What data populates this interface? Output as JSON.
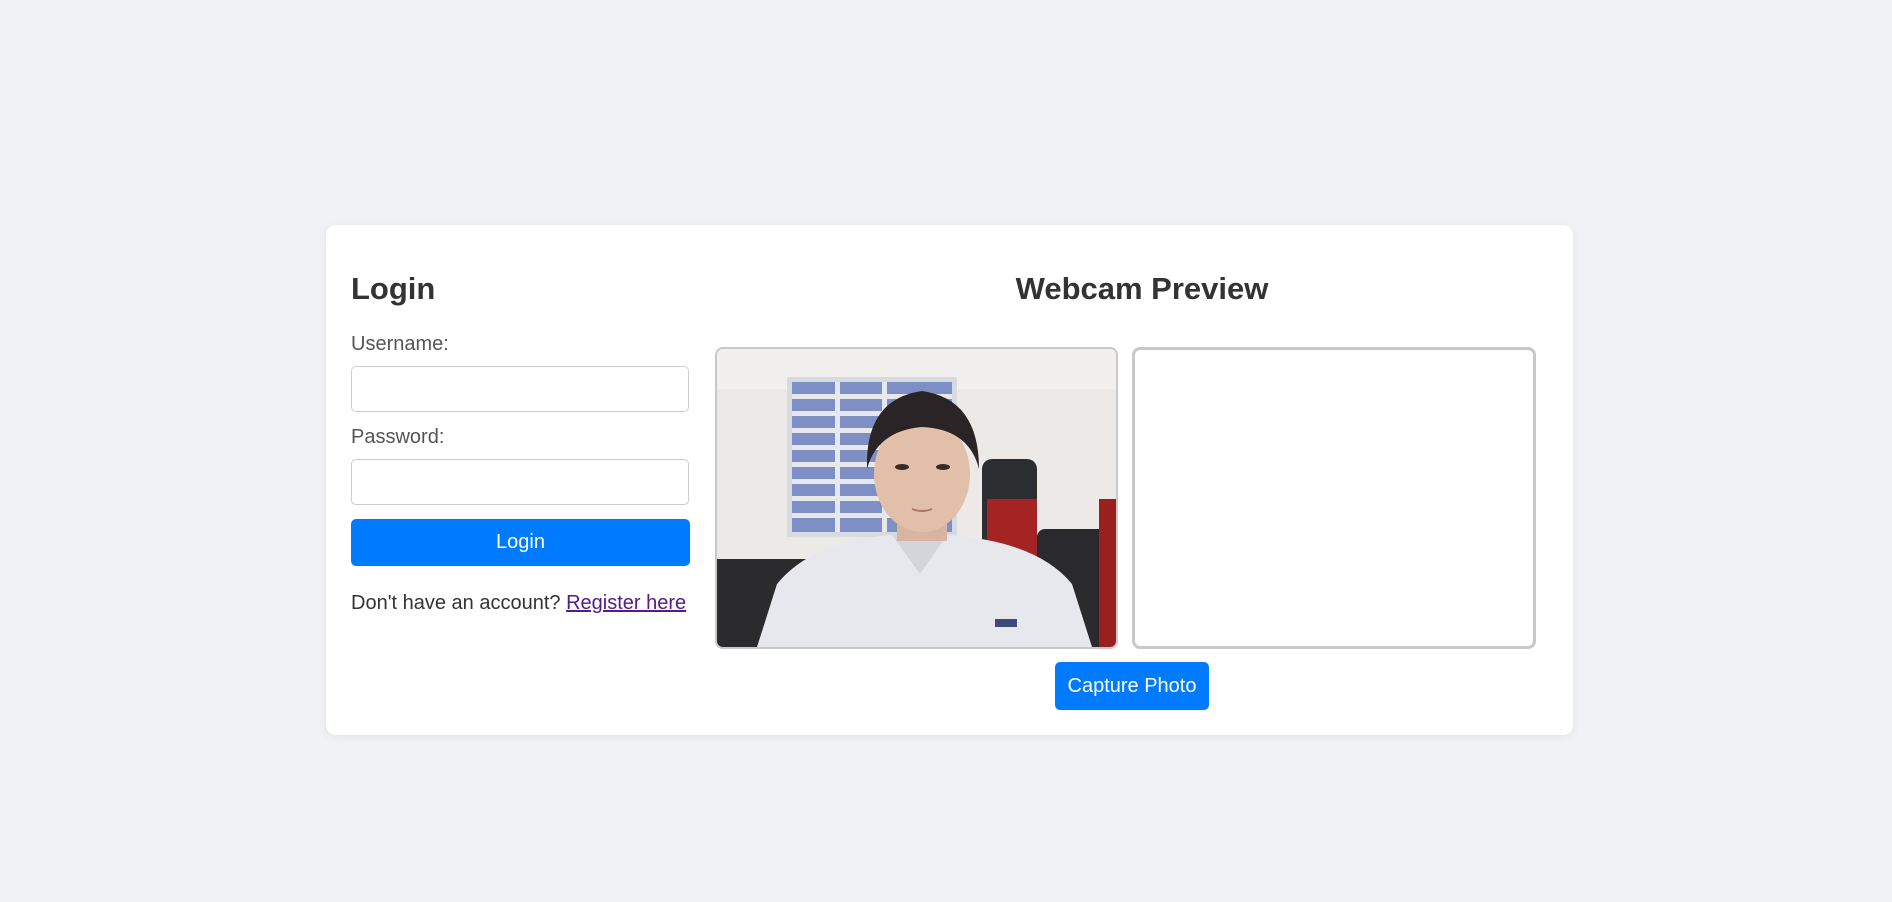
{
  "login": {
    "title": "Login",
    "username_label": "Username:",
    "username_value": "",
    "password_label": "Password:",
    "password_value": "",
    "login_button": "Login",
    "register_prompt": "Don't have an account?",
    "register_link": "Register here"
  },
  "webcam": {
    "title": "Webcam Preview",
    "capture_button": "Capture Photo"
  },
  "colors": {
    "accent": "#007bff",
    "page_background": "#f0f2f5",
    "card_background": "#ffffff",
    "visited_link": "#551a8b"
  }
}
